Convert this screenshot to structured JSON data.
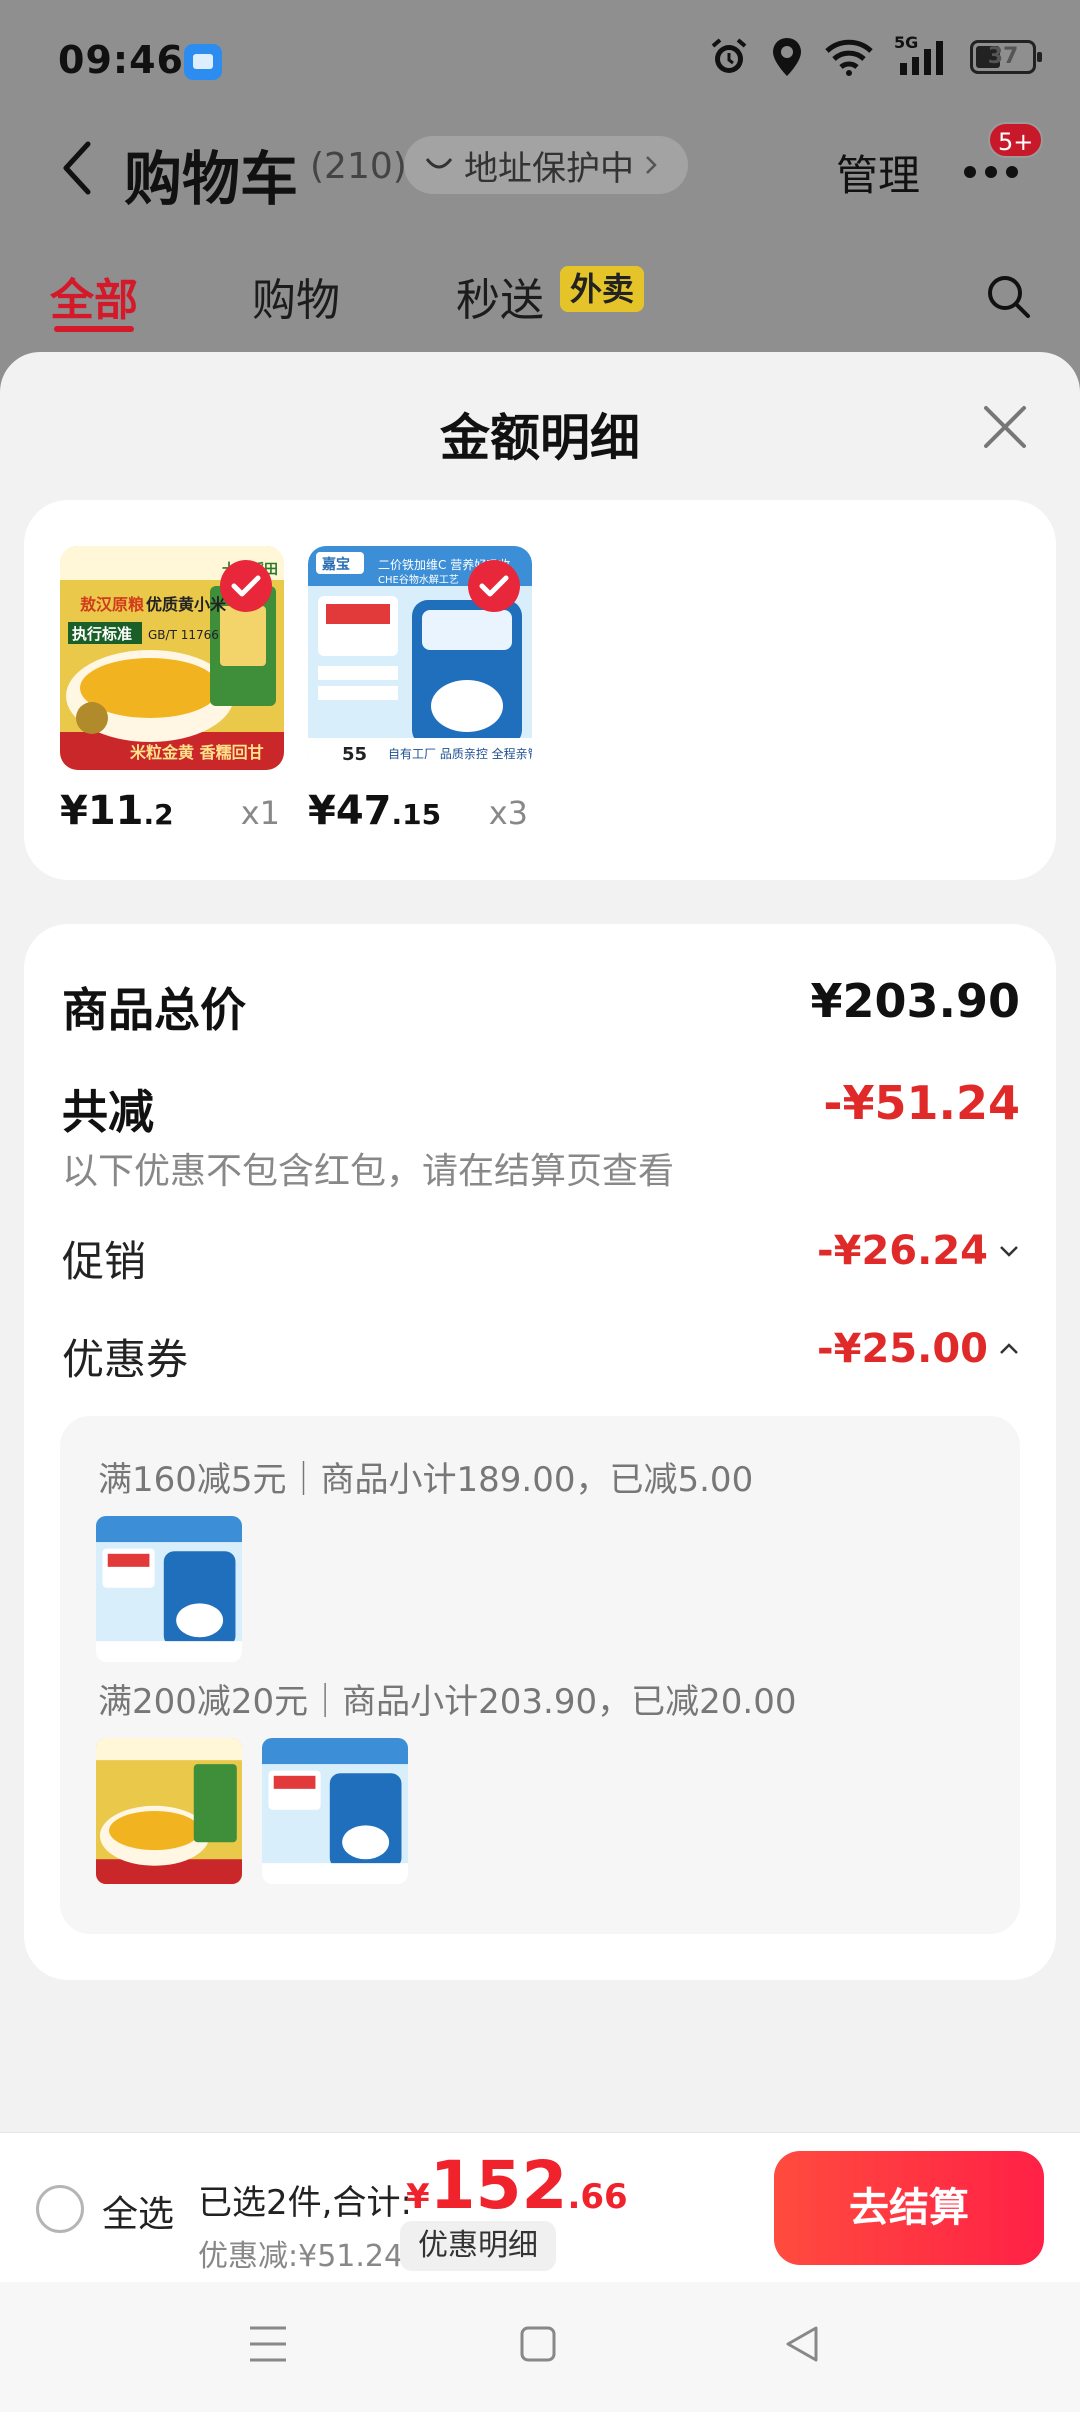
{
  "status_bar": {
    "time": "09:46",
    "network": "5G",
    "battery": "37"
  },
  "header": {
    "title": "购物车",
    "count": "(210)",
    "address_protection": "地址保护中",
    "manage": "管理",
    "badge": "5+"
  },
  "tabs": [
    {
      "label": "全部",
      "active": true
    },
    {
      "label": "购物"
    },
    {
      "label": "秒送",
      "tag": "外卖"
    }
  ],
  "sheet": {
    "title": "金额明细",
    "products": [
      {
        "price_int": "¥11",
        "price_dec": ".2",
        "qty": "x1",
        "image_texts": [
          "敖汉原粮",
          "优质黄小米",
          "执行标准",
          "GB/T 11766",
          "十月稻田",
          "米粒金黄 香糯回甘"
        ]
      },
      {
        "price_int": "¥47",
        "price_dec": ".15",
        "qty": "x3",
        "image_texts": [
          "嘉宝",
          "二价铁加维C 营养好吸收",
          "CHE谷物水解工艺",
          "55",
          "自有工厂 品质亲控 全程亲管"
        ]
      }
    ],
    "total_label": "商品总价",
    "total_value": "¥203.90",
    "reduce_label": "共减",
    "reduce_value": "-¥51.24",
    "reduce_note": "以下优惠不包含红包，请在结算页查看",
    "promo_label": "促销",
    "promo_value": "-¥26.24",
    "coupon_label": "优惠券",
    "coupon_value": "-¥25.00",
    "coupon_rules": [
      "满160减5元｜商品小计189.00，已减5.00",
      "满200减20元｜商品小计203.90，已减20.00"
    ]
  },
  "bottom_bar": {
    "select_all": "全选",
    "selected_text": "已选2件,合计:",
    "currency": "¥",
    "price_int": "152",
    "price_dec": ".66",
    "discount_text": "优惠减:¥51.24",
    "detail_button": "优惠明细",
    "checkout": "去结算"
  },
  "colors": {
    "accent": "#f0232d",
    "reduce": "#e02a2a",
    "waimai_tag": "#e5c42a",
    "checkout_start": "#ff4b3e",
    "checkout_end": "#ff2146"
  }
}
